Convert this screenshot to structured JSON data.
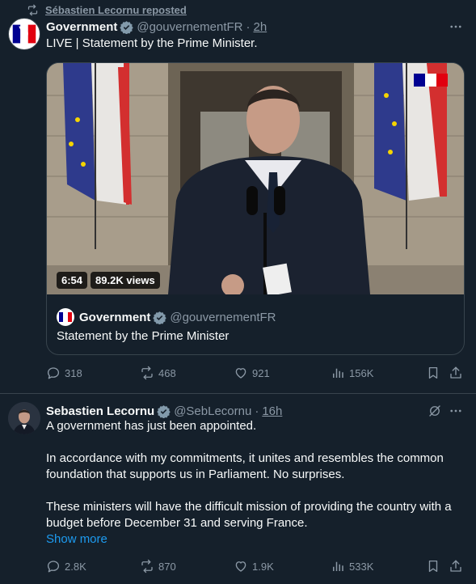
{
  "tweet1": {
    "repost_label": "Sébastien Lecornu reposted",
    "author": {
      "name": "Government",
      "handle": "@gouvernementFR",
      "time": "2h"
    },
    "text": "LIVE | Statement by the Prime Minister.",
    "video": {
      "duration": "6:54",
      "views": "89.2K views"
    },
    "quote": {
      "name": "Government",
      "handle": "@gouvernementFR",
      "text": "Statement by the Prime Minister"
    },
    "actions": {
      "replies": "318",
      "reposts": "468",
      "likes": "921",
      "views": "156K"
    }
  },
  "tweet2": {
    "author": {
      "name": "Sebastien Lecornu",
      "handle": "@SebLecornu",
      "time": "16h"
    },
    "paragraphs": [
      "A government has just been appointed.",
      "In accordance with my commitments, it unites and resembles the common foundation that supports us in Parliament. No surprises.",
      "These ministers will have the difficult mission of providing the country with a budget before December 31 and serving France."
    ],
    "show_more": "Show more",
    "actions": {
      "replies": "2.8K",
      "reposts": "870",
      "likes": "1.9K",
      "views": "533K"
    }
  },
  "colors": {
    "background": "#15202b",
    "text": "#f7f9f9",
    "secondary": "#8b98a5",
    "accent": "#1d9bf0",
    "verified": "#829aab",
    "border": "#38444d"
  },
  "icons": [
    "repost-icon",
    "verified-icon",
    "more-icon",
    "reply-icon",
    "like-icon",
    "views-icon",
    "bookmark-icon",
    "share-icon",
    "grok-icon"
  ]
}
